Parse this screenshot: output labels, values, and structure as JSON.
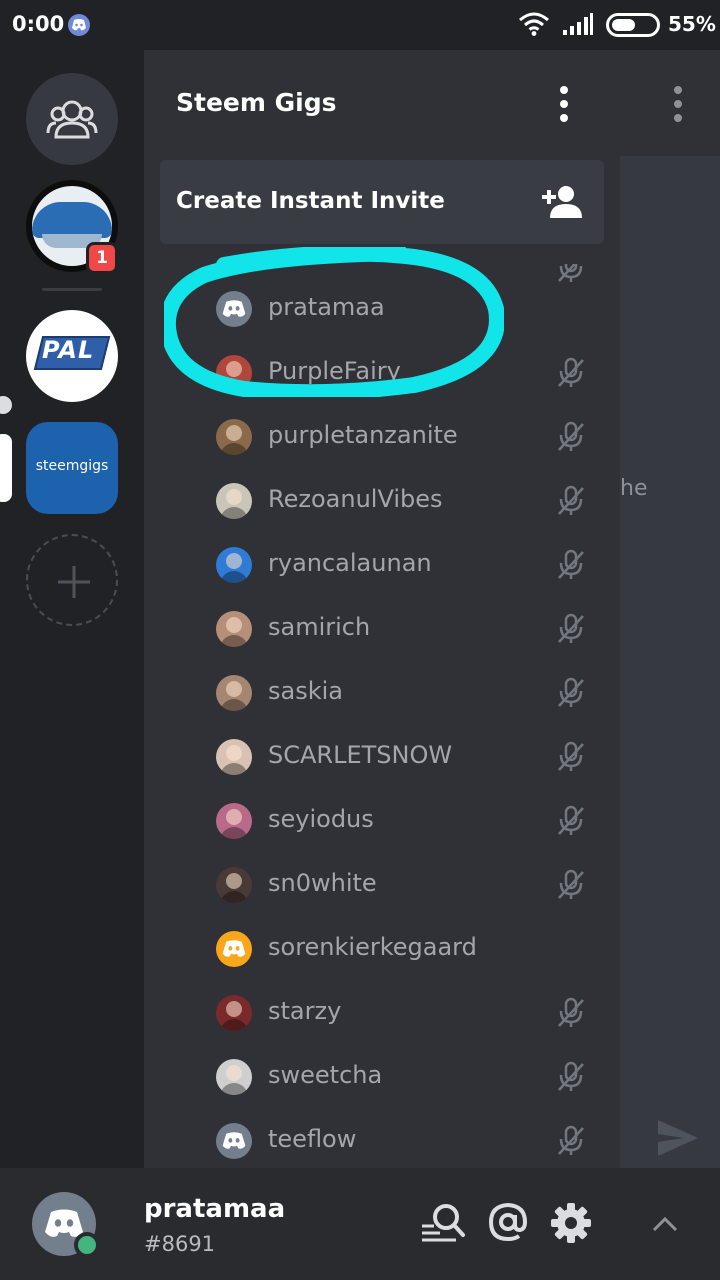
{
  "status_bar": {
    "time": "0:00",
    "battery_percent": "55%",
    "battery_level": 0.55
  },
  "guilds": {
    "unread_badge": "1",
    "pal_label": "PAL",
    "steemgigs_label": "steemgigs"
  },
  "server": {
    "name": "Steem Gigs",
    "invite_label": "Create Instant Invite"
  },
  "members": [
    {
      "name": "pratamaa",
      "avatar": "discord-default",
      "color": "#747f8d",
      "muted": false,
      "highlighted": true
    },
    {
      "name": "PurpleFairy",
      "avatar": "photo",
      "color": "#b0463c",
      "muted": true
    },
    {
      "name": "purpletanzanite",
      "avatar": "photo",
      "color": "#8a6a4a",
      "muted": true
    },
    {
      "name": "RezoanulVibes",
      "avatar": "photo",
      "color": "#c9c6b8",
      "muted": true
    },
    {
      "name": "ryancalaunan",
      "avatar": "photo",
      "color": "#2f7bd6",
      "muted": true
    },
    {
      "name": "samirich",
      "avatar": "photo",
      "color": "#b68f78",
      "muted": true
    },
    {
      "name": "saskia",
      "avatar": "photo",
      "color": "#a58670",
      "muted": true
    },
    {
      "name": "SCARLETSNOW",
      "avatar": "photo",
      "color": "#d9c2b3",
      "muted": true
    },
    {
      "name": "seyiodus",
      "avatar": "photo",
      "color": "#b86a8a",
      "muted": true
    },
    {
      "name": "sn0white",
      "avatar": "photo",
      "color": "#4a3a36",
      "muted": true
    },
    {
      "name": "sorenkierkegaard",
      "avatar": "discord-default",
      "color": "#faa61a",
      "muted": false
    },
    {
      "name": "starzy",
      "avatar": "photo",
      "color": "#7a2a2a",
      "muted": true
    },
    {
      "name": "sweetcha",
      "avatar": "photo",
      "color": "#cfcfcf",
      "muted": true
    },
    {
      "name": "teeflow",
      "avatar": "discord-default",
      "color": "#747f8d",
      "muted": true
    }
  ],
  "chat_partial_text": "he",
  "user": {
    "name": "pratamaa",
    "discriminator": "#8691",
    "status": "online",
    "status_color": "#43b581"
  }
}
